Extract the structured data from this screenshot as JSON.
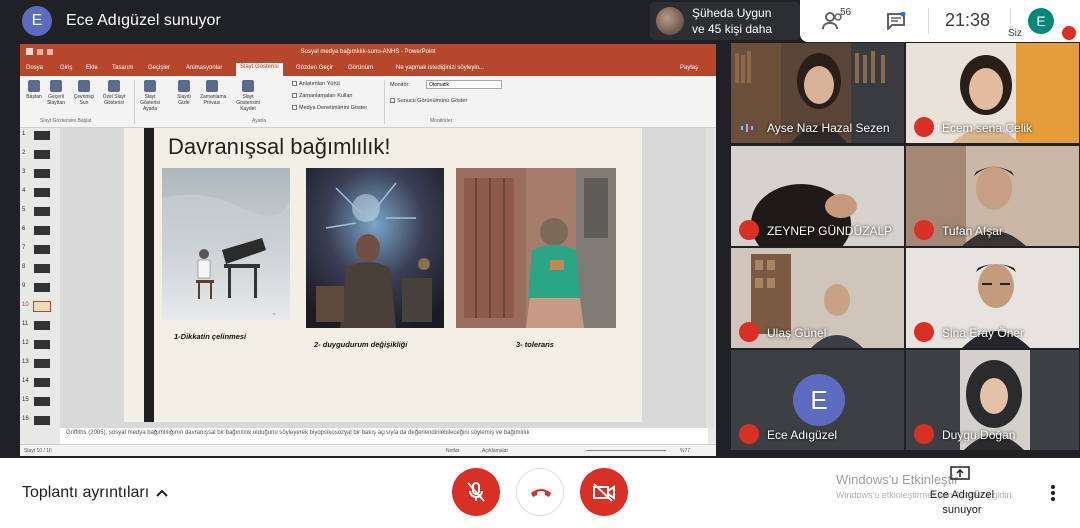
{
  "topbar": {
    "avatar_letter": "E",
    "presenter_title": "Ece Adıgüzel sunuyor",
    "pinned_line1": "Şüheda Uygun",
    "pinned_line2": "ve 45 kişi daha",
    "people_count": "56",
    "clock": "21:38",
    "self_letter": "E",
    "self_label": "Siz"
  },
  "ppt": {
    "window_title": "Sosyal medya bağımlılık-sunu-ANHS - PowerPoint",
    "tabs": [
      "Dosya",
      "Giriş",
      "Ekle",
      "Tasarım",
      "Geçişler",
      "Animasyonlar",
      "Slayt Gösterisi",
      "Gözden Geçir",
      "Görünüm",
      "Ne yapmak istediğinizi söyleyin...",
      "Paylaş"
    ],
    "ribbon": {
      "btn_bastan": "Baştan",
      "btn_gecerli": "Geçerli Slayttan",
      "btn_cevrimici": "Çevrimiçi Sun",
      "btn_ozel": "Özel Slayt Gösterisi",
      "btn_ayarla": "Slayt Gösterisi Ayarla",
      "btn_gizle": "Slaydı Gizle",
      "btn_zamanlama": "Zamanlama Provası",
      "btn_kaydet": "Slayt Gösterisini Kaydet",
      "chk_anlatim": "Anlatımları Yürüt",
      "chk_zaman": "Zamanlamaları Kullan",
      "chk_medya": "Medya Denetimlerini Göster",
      "monitor_label": "Monitör:",
      "monitor_value": "Otomatik",
      "chk_sunucu": "Sunucu Görünümünü Göster",
      "group_basla": "Slayt Gösterisini Başlat",
      "group_ayarla": "Ayarla",
      "group_monitor": "Monitörler"
    },
    "thumb_numbers": [
      "1",
      "2",
      "3",
      "4",
      "5",
      "6",
      "7",
      "8",
      "9",
      "10",
      "11",
      "12",
      "13",
      "14",
      "15",
      "16"
    ],
    "slide": {
      "title": "Davranışsal bağımlılık!",
      "caption1": "1-Dikkatin çelinmesi",
      "caption2": "2- duygudurum değişikliği",
      "caption3": "3- tolerans"
    },
    "notes": "Griffiths (2005), sosyal medya bağımlılığının davranışsal bir bağımlılık olduğunu söyleyerek biyopsikosozyal bir bakış açısıyla da değerlendirilebileceğini söylemiş ve bağımlılık",
    "status_slide": "Slayt 10 / 16",
    "status_notes": "Notlar",
    "status_comments": "Açıklamalar",
    "status_zoom": "%77"
  },
  "participants": [
    {
      "name": "Ayse Naz Hazal Sezen",
      "muted": false
    },
    {
      "name": "Ecem sena Çelik",
      "muted": true
    },
    {
      "name": "ZEYNEP GÜNDÜZALP",
      "muted": true
    },
    {
      "name": "Tufan Afşar",
      "muted": true
    },
    {
      "name": "Ulaş Günel",
      "muted": true
    },
    {
      "name": "Sina Eray Öner",
      "muted": true
    },
    {
      "name": "Ece Adıgüzel",
      "muted": true
    },
    {
      "name": "Duygu Doğan",
      "muted": true
    }
  ],
  "bottom": {
    "meeting_details": "Toplantı ayrıntıları",
    "watermark_line1": "Windows'u Etkinleştir",
    "watermark_line2": "Windows'u etkinleştirmek için Ayarlar'a gidin.",
    "present_label": "Ece Adıgüzel sunuyor"
  },
  "colors": {
    "meet_red": "#d93025",
    "ppt_brand": "#b7472a",
    "avatar_blue": "#5c6bc0"
  }
}
